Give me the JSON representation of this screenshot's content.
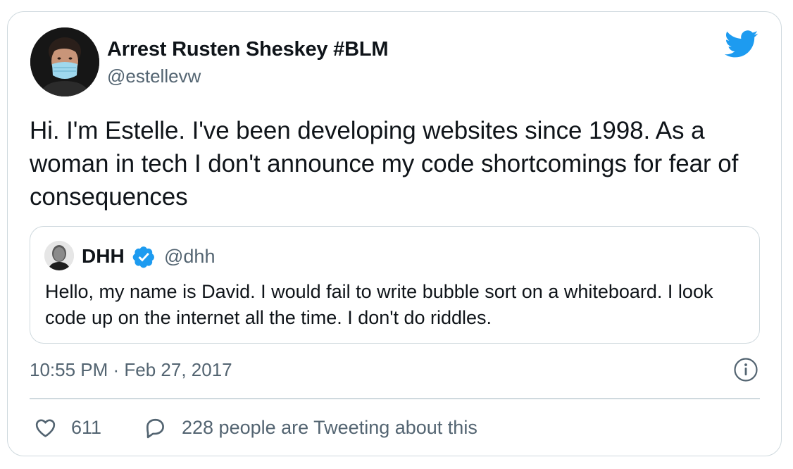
{
  "tweet": {
    "display_name": "Arrest Rusten Sheskey #BLM",
    "handle": "@estellevw",
    "text": "Hi. I'm Estelle. I've been developing websites since 1998. As a woman in tech I don't announce my code shortcomings for fear of consequences",
    "timestamp": "10:55 PM · Feb 27, 2017",
    "like_count": "611",
    "reply_text": "228 people are Tweeting about this"
  },
  "quoted_tweet": {
    "name": "DHH",
    "handle": "@dhh",
    "text": "Hello, my name is David. I would fail to write bubble sort on a whiteboard. I look code up on the internet all the time. I don't do riddles."
  },
  "icons": {
    "brand": "twitter-bird-icon",
    "verified": "verified-badge-icon",
    "info": "info-icon",
    "like": "heart-icon",
    "reply": "speech-bubble-icon"
  },
  "colors": {
    "brand": "#1d9bf0",
    "text": "#0f1419",
    "secondary": "#536471",
    "border": "#cfd9de"
  }
}
